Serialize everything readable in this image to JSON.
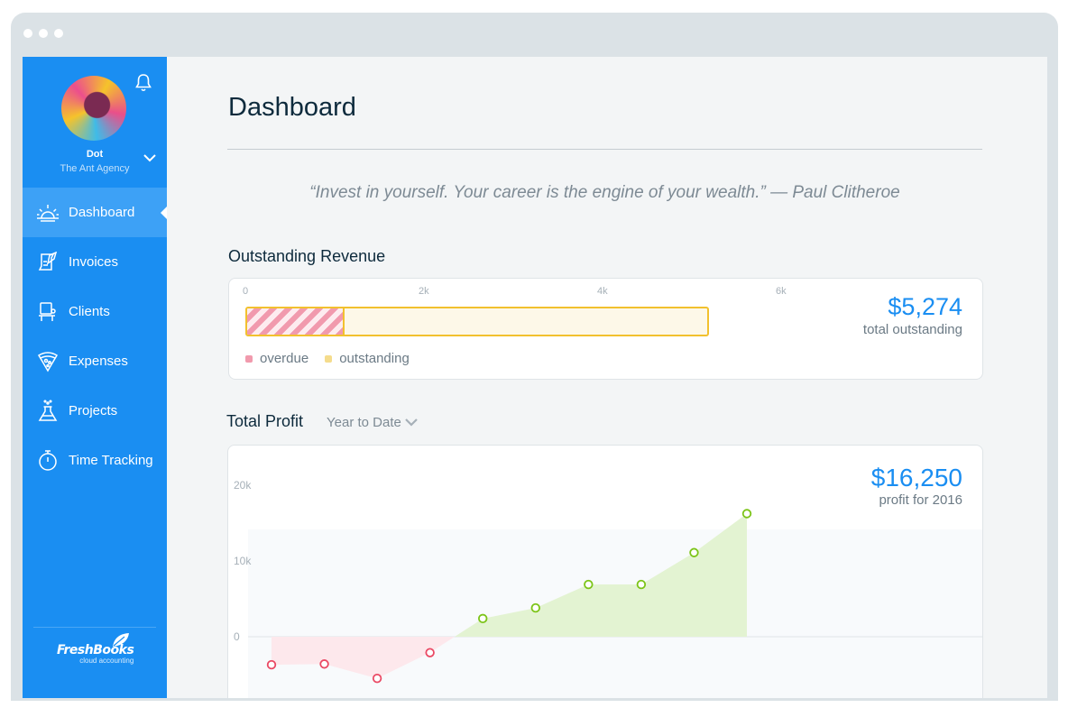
{
  "user": {
    "name": "Dot",
    "org": "The Ant Agency"
  },
  "sidebar": {
    "items": [
      {
        "label": "Dashboard",
        "icon": "sunrise-icon",
        "active": true
      },
      {
        "label": "Invoices",
        "icon": "invoice-quill-icon"
      },
      {
        "label": "Clients",
        "icon": "client-desk-icon"
      },
      {
        "label": "Expenses",
        "icon": "pizza-slice-icon"
      },
      {
        "label": "Projects",
        "icon": "flask-icon"
      },
      {
        "label": "Time Tracking",
        "icon": "stopwatch-icon"
      }
    ],
    "logo": {
      "brand": "FreshBooks",
      "tagline": "cloud accounting"
    }
  },
  "main": {
    "title": "Dashboard",
    "quote": "“Invest in yourself. Your career is the engine of your wealth.” — Paul Clitheroe"
  },
  "outstanding": {
    "title": "Outstanding Revenue",
    "value": "$5,274",
    "caption": "total outstanding",
    "axis": [
      "0",
      "2k",
      "4k",
      "6k"
    ],
    "legend": {
      "overdue": "overdue",
      "outstanding": "outstanding"
    },
    "colors": {
      "overdue": "#f19aad",
      "outstanding": "#f5dc8c",
      "border": "#f2c12e"
    }
  },
  "profit": {
    "title": "Total Profit",
    "period": "Year to Date",
    "value": "$16,250",
    "caption": "profit for 2016"
  },
  "colors": {
    "accent": "#1a8ef2",
    "positive": "#7cc418",
    "negative": "#ea4964"
  },
  "chart_data": [
    {
      "type": "bar",
      "title": "Outstanding Revenue",
      "orientation": "horizontal",
      "xlim": [
        0,
        6000
      ],
      "ticks": [
        "0",
        "2k",
        "4k",
        "6k"
      ],
      "series": [
        {
          "name": "overdue",
          "values": [
            1100
          ]
        },
        {
          "name": "outstanding",
          "values": [
            5274
          ]
        }
      ],
      "legend_placement": "bottom-left"
    },
    {
      "type": "area",
      "title": "Total Profit",
      "ylim": [
        -5000,
        20000
      ],
      "ticks": [
        "20k",
        "10k",
        "0"
      ],
      "x": [
        1,
        2,
        3,
        4,
        5,
        6,
        7,
        8,
        9,
        10
      ],
      "values": [
        -3700,
        -3600,
        -5500,
        -2100,
        2400,
        3800,
        6900,
        6900,
        11100,
        16250
      ],
      "grid": true
    }
  ]
}
